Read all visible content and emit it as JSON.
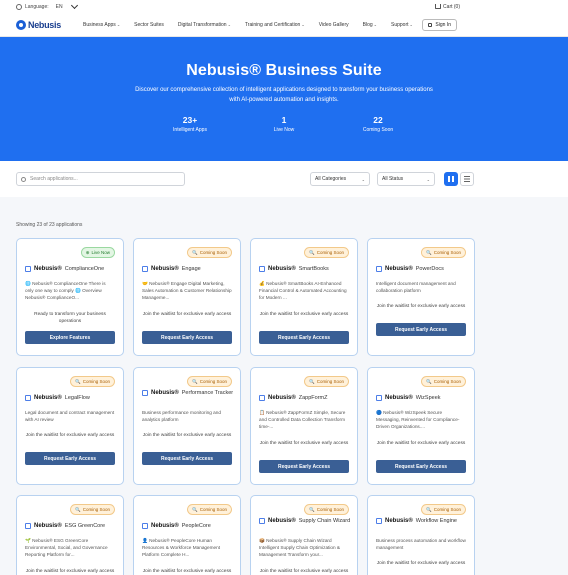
{
  "topbar": {
    "language_label": "Language:",
    "language_value": "EN",
    "cart": "Cart (0)"
  },
  "nav": {
    "logo": "Nebusis",
    "items": [
      "Business Apps",
      "Sector Suites",
      "Digital Transformation",
      "Training and Certification",
      "Video Gallery",
      "Blog",
      "Support"
    ],
    "signin": "Sign In"
  },
  "hero": {
    "title": "Nebusis® Business Suite",
    "subtitle": "Discover our comprehensive collection of intelligent applications designed to transform your business operations with AI-powered automation and insights.",
    "stats": [
      {
        "value": "23+",
        "label": "Intelligent Apps"
      },
      {
        "value": "1",
        "label": "Live Now"
      },
      {
        "value": "22",
        "label": "Coming Soon"
      }
    ]
  },
  "filters": {
    "search_placeholder": "Search applications...",
    "categories": "All Categories",
    "status": "All Status"
  },
  "showing": "Showing 23 of 23 applications",
  "cards": [
    {
      "badge": "Live Now",
      "live": true,
      "brand": "Nebusis®",
      "name": "ComplianceOne",
      "desc": "🌐 Nebusis® ComplianceOne There is only one way to comply 🌐 Overview Nebusis® ComplianceO...",
      "wait": "Ready to transform your business operations",
      "button": "Explore Features"
    },
    {
      "badge": "Coming Soon",
      "brand": "Nebusis®",
      "name": "Engage",
      "desc": "🤝 Nebusis® Engage Digital Marketing, Sales Automation & Customer Relationship Manageme...",
      "wait": "Join the waitlist for exclusive early access",
      "button": "Request Early Access"
    },
    {
      "badge": "Coming Soon",
      "brand": "Nebusis®",
      "name": "SmartBooks",
      "desc": "💰 Nebusis® SmartBooks AI-Enhanced Financial Control & Automated Accounting for Modern ...",
      "wait": "Join the waitlist for exclusive early access",
      "button": "Request Early Access"
    },
    {
      "badge": "Coming Soon",
      "brand": "Nebusis®",
      "name": "PowerDocs",
      "desc": "Intelligent document management and collaboration platform",
      "wait": "Join the waitlist for exclusive early access",
      "button": "Request Early Access"
    },
    {
      "badge": "Coming Soon",
      "brand": "Nebusis®",
      "name": "LegalFlow",
      "desc": "Legal document and contract management with AI review",
      "wait": "Join the waitlist for exclusive early access",
      "button": "Request Early Access"
    },
    {
      "badge": "Coming Soon",
      "brand": "Nebusis®",
      "name": "Performance Tracker",
      "desc": "Business performance monitoring and analytics platform",
      "wait": "Join the waitlist for exclusive early access",
      "button": "Request Early Access"
    },
    {
      "badge": "Coming Soon",
      "brand": "Nebusis®",
      "name": "ZappFormZ",
      "desc": "📋 Nebusis® ZappFormZ Simple, Secure and Controlled Data Collection Transform time-...",
      "wait": "Join the waitlist for exclusive early access",
      "button": "Request Early Access"
    },
    {
      "badge": "Coming Soon",
      "brand": "Nebusis®",
      "name": "WizSpeek",
      "desc": "🔵 Nebusis® WizSpeek Secure Messaging, Reinvented for Compliance-Driven Organizations....",
      "wait": "Join the waitlist for exclusive early access",
      "button": "Request Early Access"
    },
    {
      "badge": "Coming Soon",
      "brand": "Nebusis®",
      "name": "ESG GreenCore",
      "desc": "🌱 Nebusis® ESG GreenCore Environmental, Social, and Governance Reporting Platform for...",
      "wait": "Join the waitlist for exclusive early access",
      "button": ""
    },
    {
      "badge": "Coming Soon",
      "brand": "Nebusis®",
      "name": "PeopleCore",
      "desc": "👤 Nebusis® PeopleCore Human Resources & Workforce Management Platform Complete H...",
      "wait": "Join the waitlist for exclusive early access",
      "button": ""
    },
    {
      "badge": "Coming Soon",
      "brand": "Nebusis®",
      "name": "Supply Chain Wizard",
      "desc": "📦 Nebusis® Supply Chain Wizard Intelligent Supply Chain Optimization & Management Transform your...",
      "wait": "Join the waitlist for exclusive early access",
      "button": ""
    },
    {
      "badge": "Coming Soon",
      "brand": "Nebusis®",
      "name": "Workflow Engine",
      "desc": "Business process automation and workflow management",
      "wait": "Join the waitlist for exclusive early access",
      "button": ""
    }
  ]
}
